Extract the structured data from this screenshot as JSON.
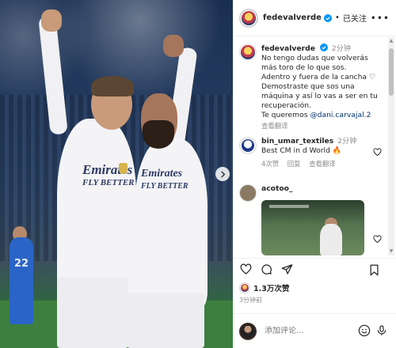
{
  "header": {
    "username": "fedevalverde",
    "separator": "•",
    "follow_label": "已关注",
    "more_label": "•••"
  },
  "photo": {
    "jersey_sponsor": "Emirates",
    "jersey_tagline": "FLY BETTER",
    "background_number": "22"
  },
  "caption": {
    "username": "fedevalverde",
    "time": "2分钟",
    "lines": [
      "No tengo dudas que volverás más toro de lo que sos.",
      "Adentro y fuera de la cancha ♡",
      "Demostraste que sos una máquina y así lo vas a ser en tu recuperación.",
      "Te queremos "
    ],
    "mention": "@dani.carvajal.2",
    "translate": "查看翻译"
  },
  "comments": [
    {
      "username": "bin_umar_textiles",
      "time": "2分钟",
      "text": "Best CM in d World ",
      "emoji": "🔥",
      "likes": "4次赞",
      "reply": "回复",
      "translate": "查看翻译"
    },
    {
      "username": "acotoo_"
    }
  ],
  "actions": {
    "likes_count": "1.3万次赞",
    "posted_time": "3分钟前"
  },
  "composer": {
    "placeholder": "添加评论..."
  },
  "colors": {
    "text": "#262626",
    "secondary": "#8e8e8e",
    "link": "#00376b",
    "verified": "#0095f6"
  }
}
